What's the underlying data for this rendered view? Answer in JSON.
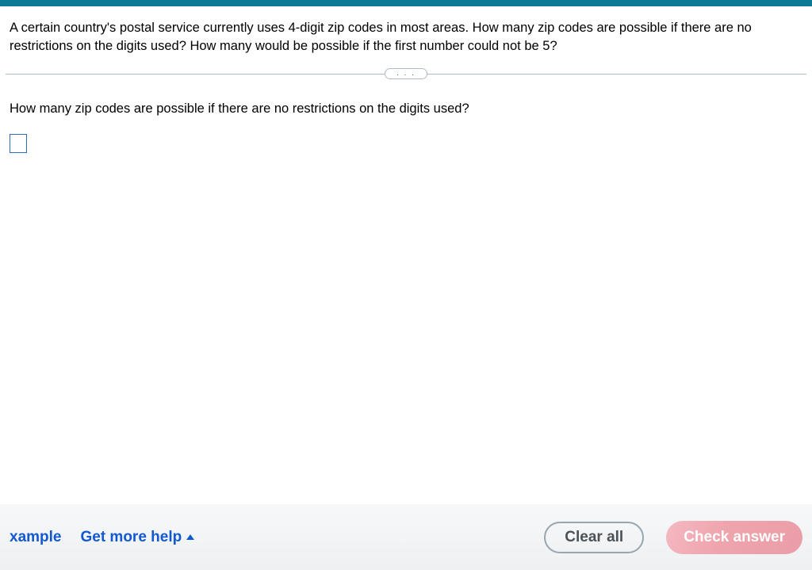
{
  "question": {
    "main_text": "A certain country's postal service currently uses 4-digit zip codes in most areas. How many zip codes are possible if there are no restrictions on the digits used? How many would be possible if the first number could not be 5?",
    "sub_text": "How many zip codes are possible if there are no restrictions on the digits used?",
    "answer_value": ""
  },
  "divider": {
    "dots": ". . ."
  },
  "footer": {
    "example_label": "xample",
    "help_label": "Get more help",
    "clear_label": "Clear all",
    "check_label": "Check answer"
  }
}
